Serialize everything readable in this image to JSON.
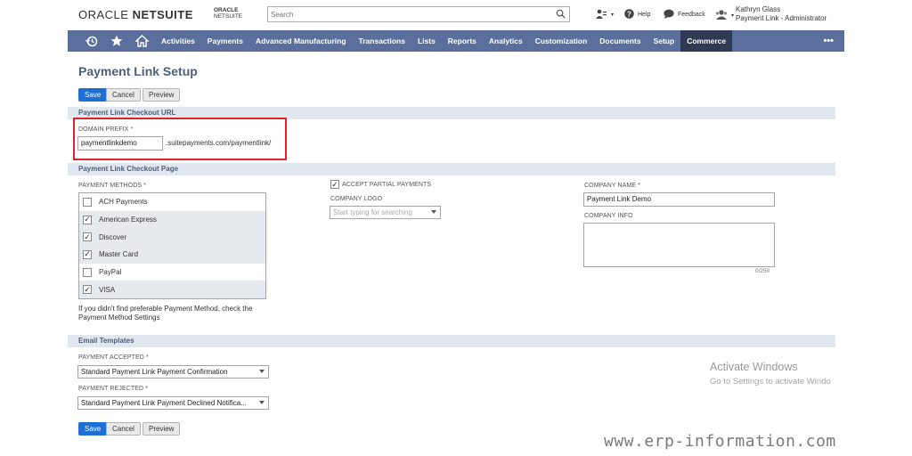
{
  "header": {
    "logo_a": "ORACLE",
    "logo_b": "NETSUITE",
    "logo2_a": "ORACLE",
    "logo2_b": "NETSUITE",
    "search_placeholder": "Search",
    "help": "Help",
    "feedback": "Feedback",
    "user_name": "Kathryn Glass",
    "user_role": "Payment Link - Administrator"
  },
  "nav": {
    "items": [
      "Activities",
      "Payments",
      "Advanced Manufacturing",
      "Transactions",
      "Lists",
      "Reports",
      "Analytics",
      "Customization",
      "Documents",
      "Setup",
      "Commerce"
    ],
    "more": "•••"
  },
  "page": {
    "title": "Payment Link Setup"
  },
  "buttons": {
    "save": "Save",
    "cancel": "Cancel",
    "preview": "Preview"
  },
  "checkout_url": {
    "section": "Payment Link Checkout URL",
    "domain_label": "DOMAIN PREFIX *",
    "domain_value": "paymentlinkdemo",
    "domain_suffix": ".suitepayments.com/paymentlink/"
  },
  "checkout_page": {
    "section": "Payment Link Checkout Page",
    "methods_label": "PAYMENT METHODS *",
    "methods": [
      {
        "label": "ACH Payments",
        "checked": false
      },
      {
        "label": "American Express",
        "checked": true
      },
      {
        "label": "Discover",
        "checked": true
      },
      {
        "label": "Master Card",
        "checked": true
      },
      {
        "label": "PayPal",
        "checked": false
      },
      {
        "label": "VISA",
        "checked": true
      }
    ],
    "hint_line1": "If you didn't find preferable Payment Method, check the",
    "hint_line2": "Payment Method Settings",
    "partial_label": "ACCEPT PARTIAL PAYMENTS",
    "partial_checked": true,
    "logo_label": "COMPANY LOGO",
    "logo_placeholder": "Start typing for searching",
    "company_name_label": "COMPANY NAME *",
    "company_name_value": "Payment Link Demo",
    "company_info_label": "COMPANY INFO",
    "char_count": "0/250"
  },
  "email": {
    "section": "Email Templates",
    "accepted_label": "PAYMENT ACCEPTED *",
    "accepted_value": "Standard Payment Link Payment Confirmation",
    "rejected_label": "PAYMENT REJECTED *",
    "rejected_value": "Standard Payment Link Payment Declined Notifica..."
  },
  "overlay": {
    "activate_title": "Activate Windows",
    "activate_sub": "Go to Settings to activate Windo",
    "site": "www.erp-information.com"
  },
  "colors": {
    "nav_bg": "#5a6f9c",
    "nav_active": "#2f3b54",
    "primary": "#1d6fd3",
    "highlight": "#d9262c"
  }
}
